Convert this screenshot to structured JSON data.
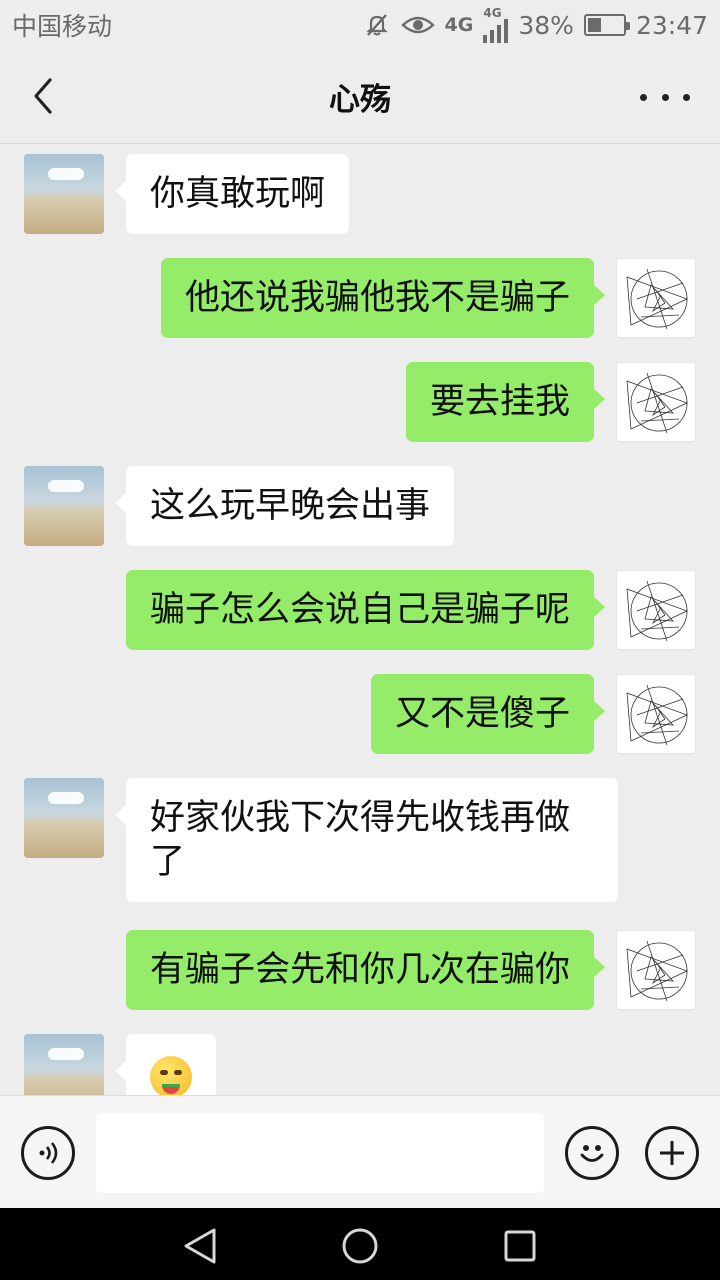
{
  "status_bar": {
    "carrier": "中国移动",
    "network_1": "4G",
    "network_2": "4G",
    "battery_percent": "38%",
    "battery_level": 0.38,
    "time": "23:47",
    "icons": [
      "mute-icon",
      "eye-comfort-icon",
      "signal-icon",
      "battery-icon"
    ]
  },
  "header": {
    "title": "心殇",
    "back_icon": "chevron-left-icon",
    "more_icon": "more-dots-icon"
  },
  "messages": [
    {
      "side": "in",
      "text": "你真敢玩啊"
    },
    {
      "side": "out",
      "text": "他还说我骗他我不是骗子"
    },
    {
      "side": "out",
      "text": "要去挂我"
    },
    {
      "side": "in",
      "text": "这么玩早晚会出事"
    },
    {
      "side": "out",
      "text": "骗子怎么会说自己是骗子呢"
    },
    {
      "side": "out",
      "text": "又不是傻子"
    },
    {
      "side": "in",
      "text": "好家伙我下次得先收钱再做了"
    },
    {
      "side": "out",
      "text": "有骗子会先和你几次在骗你"
    },
    {
      "side": "in",
      "text": "",
      "emoji": "watermelon-eating-emoji"
    }
  ],
  "input_bar": {
    "voice_icon": "voice-icon",
    "input_value": "",
    "emoji_icon": "smiley-icon",
    "plus_icon": "plus-icon"
  },
  "nav_bar": {
    "icons": [
      "nav-back-icon",
      "nav-home-icon",
      "nav-recent-icon"
    ]
  },
  "colors": {
    "outgoing_bubble": "#95ec69",
    "incoming_bubble": "#ffffff",
    "background": "#ededed"
  }
}
